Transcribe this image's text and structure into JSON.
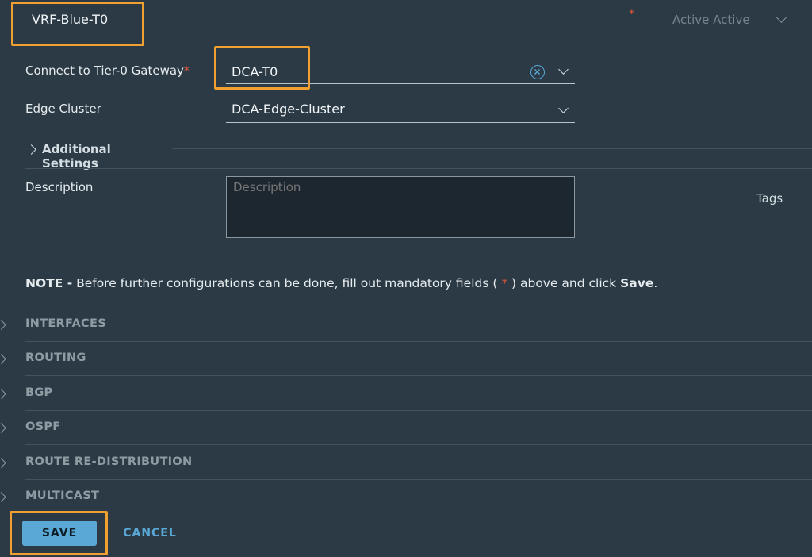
{
  "gateway": {
    "name_value": "VRF-Blue-T0",
    "ha_mode": "Active Active"
  },
  "fields": {
    "tier0_label": "Connect to Tier-0 Gateway",
    "tier0_value": "DCA-T0",
    "edge_cluster_label": "Edge Cluster",
    "edge_cluster_value": "DCA-Edge-Cluster",
    "additional_settings_label": "Additional Settings",
    "description_label": "Description",
    "description_placeholder": "Description",
    "tags_label": "Tags"
  },
  "note": {
    "prefix": "NOTE -",
    "text_before": " Before further configurations can be done, fill out mandatory fields ( ",
    "star": "*",
    "text_after": " ) above and click ",
    "save_word": "Save",
    "period": "."
  },
  "sections": [
    {
      "label": "INTERFACES"
    },
    {
      "label": "ROUTING"
    },
    {
      "label": "BGP"
    },
    {
      "label": "OSPF"
    },
    {
      "label": "ROUTE RE-DISTRIBUTION"
    },
    {
      "label": "MULTICAST"
    }
  ],
  "actions": {
    "save_label": "SAVE",
    "cancel_label": "CANCEL"
  },
  "colors": {
    "background": "#2b3a45",
    "highlight": "#f0a030",
    "accent": "#5aa8d6",
    "required": "#e8573b"
  }
}
